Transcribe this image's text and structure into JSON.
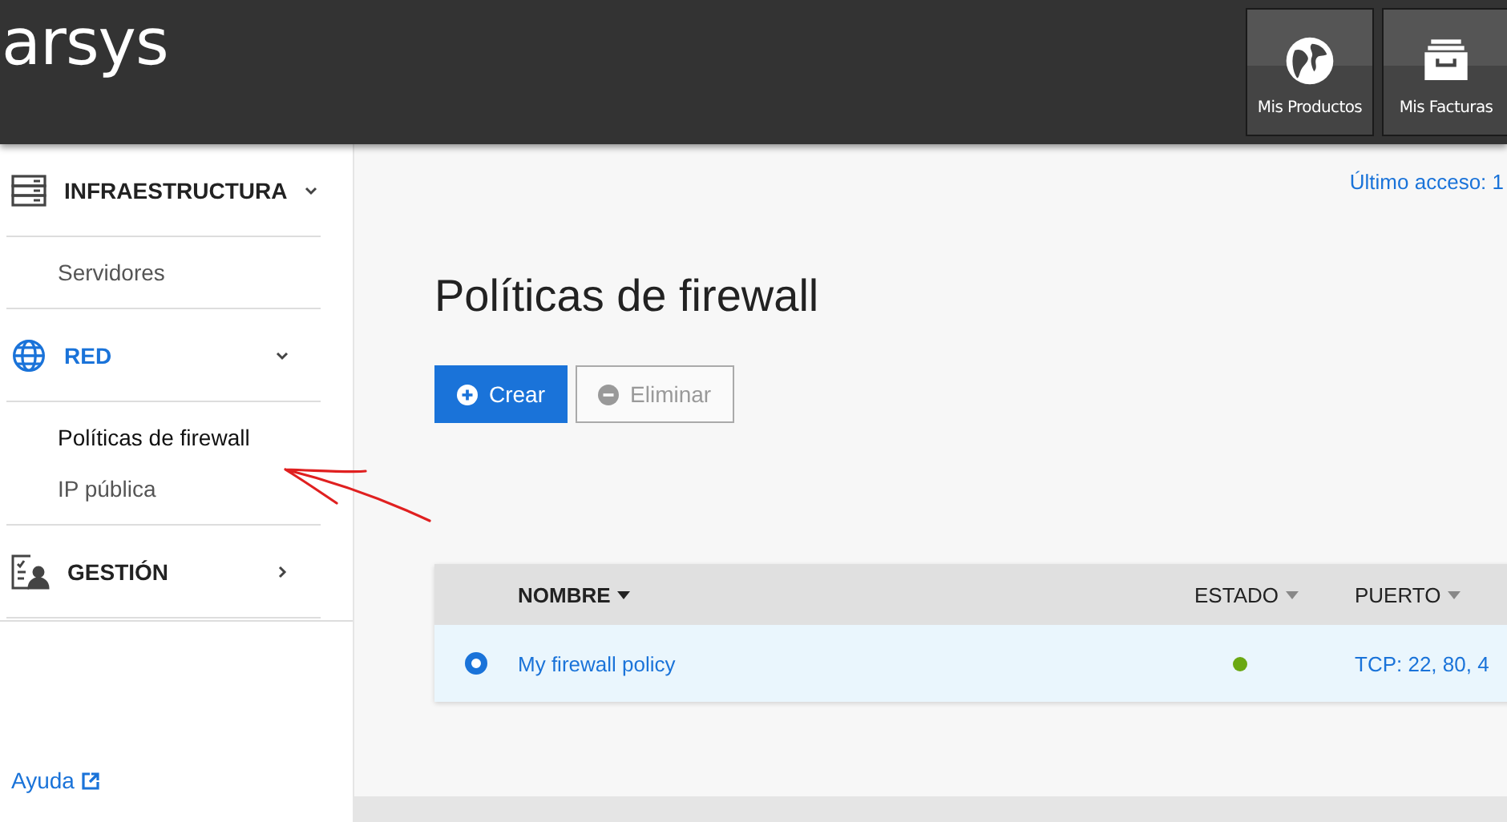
{
  "logo": "arsys",
  "header_buttons": [
    {
      "label": "Mis Productos",
      "kind": "globe"
    },
    {
      "label": "Mis Facturas",
      "kind": "drawer"
    }
  ],
  "sidebar": {
    "sections": [
      {
        "label": "INFRAESTRUCTURA",
        "kind": "servers",
        "expanded": true,
        "active": false,
        "children": [
          {
            "label": "Servidores",
            "selected": false
          }
        ]
      },
      {
        "label": "RED",
        "kind": "globe",
        "expanded": true,
        "active": true,
        "children": [
          {
            "label": "Políticas de firewall",
            "selected": true
          },
          {
            "label": "IP pública",
            "selected": false
          }
        ]
      },
      {
        "label": "GESTIÓN",
        "kind": "person",
        "expanded": false,
        "active": false
      }
    ],
    "help": "Ayuda"
  },
  "last_access": "Último acceso: 1",
  "page_title": "Políticas de firewall",
  "actions": [
    {
      "label": "Crear",
      "kind": "add",
      "disabled": false
    },
    {
      "label": "Eliminar",
      "kind": "remove",
      "disabled": true
    }
  ],
  "table": {
    "columns": [
      {
        "label": "NOMBRE",
        "sorted": true
      },
      {
        "label": "ESTADO",
        "sorted": false
      },
      {
        "label": "PUERTO",
        "sorted": false
      }
    ],
    "rows": [
      {
        "name": "My firewall policy",
        "color": "#6aa812",
        "port": "TCP: 22, 80, 4",
        "selected": true
      }
    ]
  }
}
